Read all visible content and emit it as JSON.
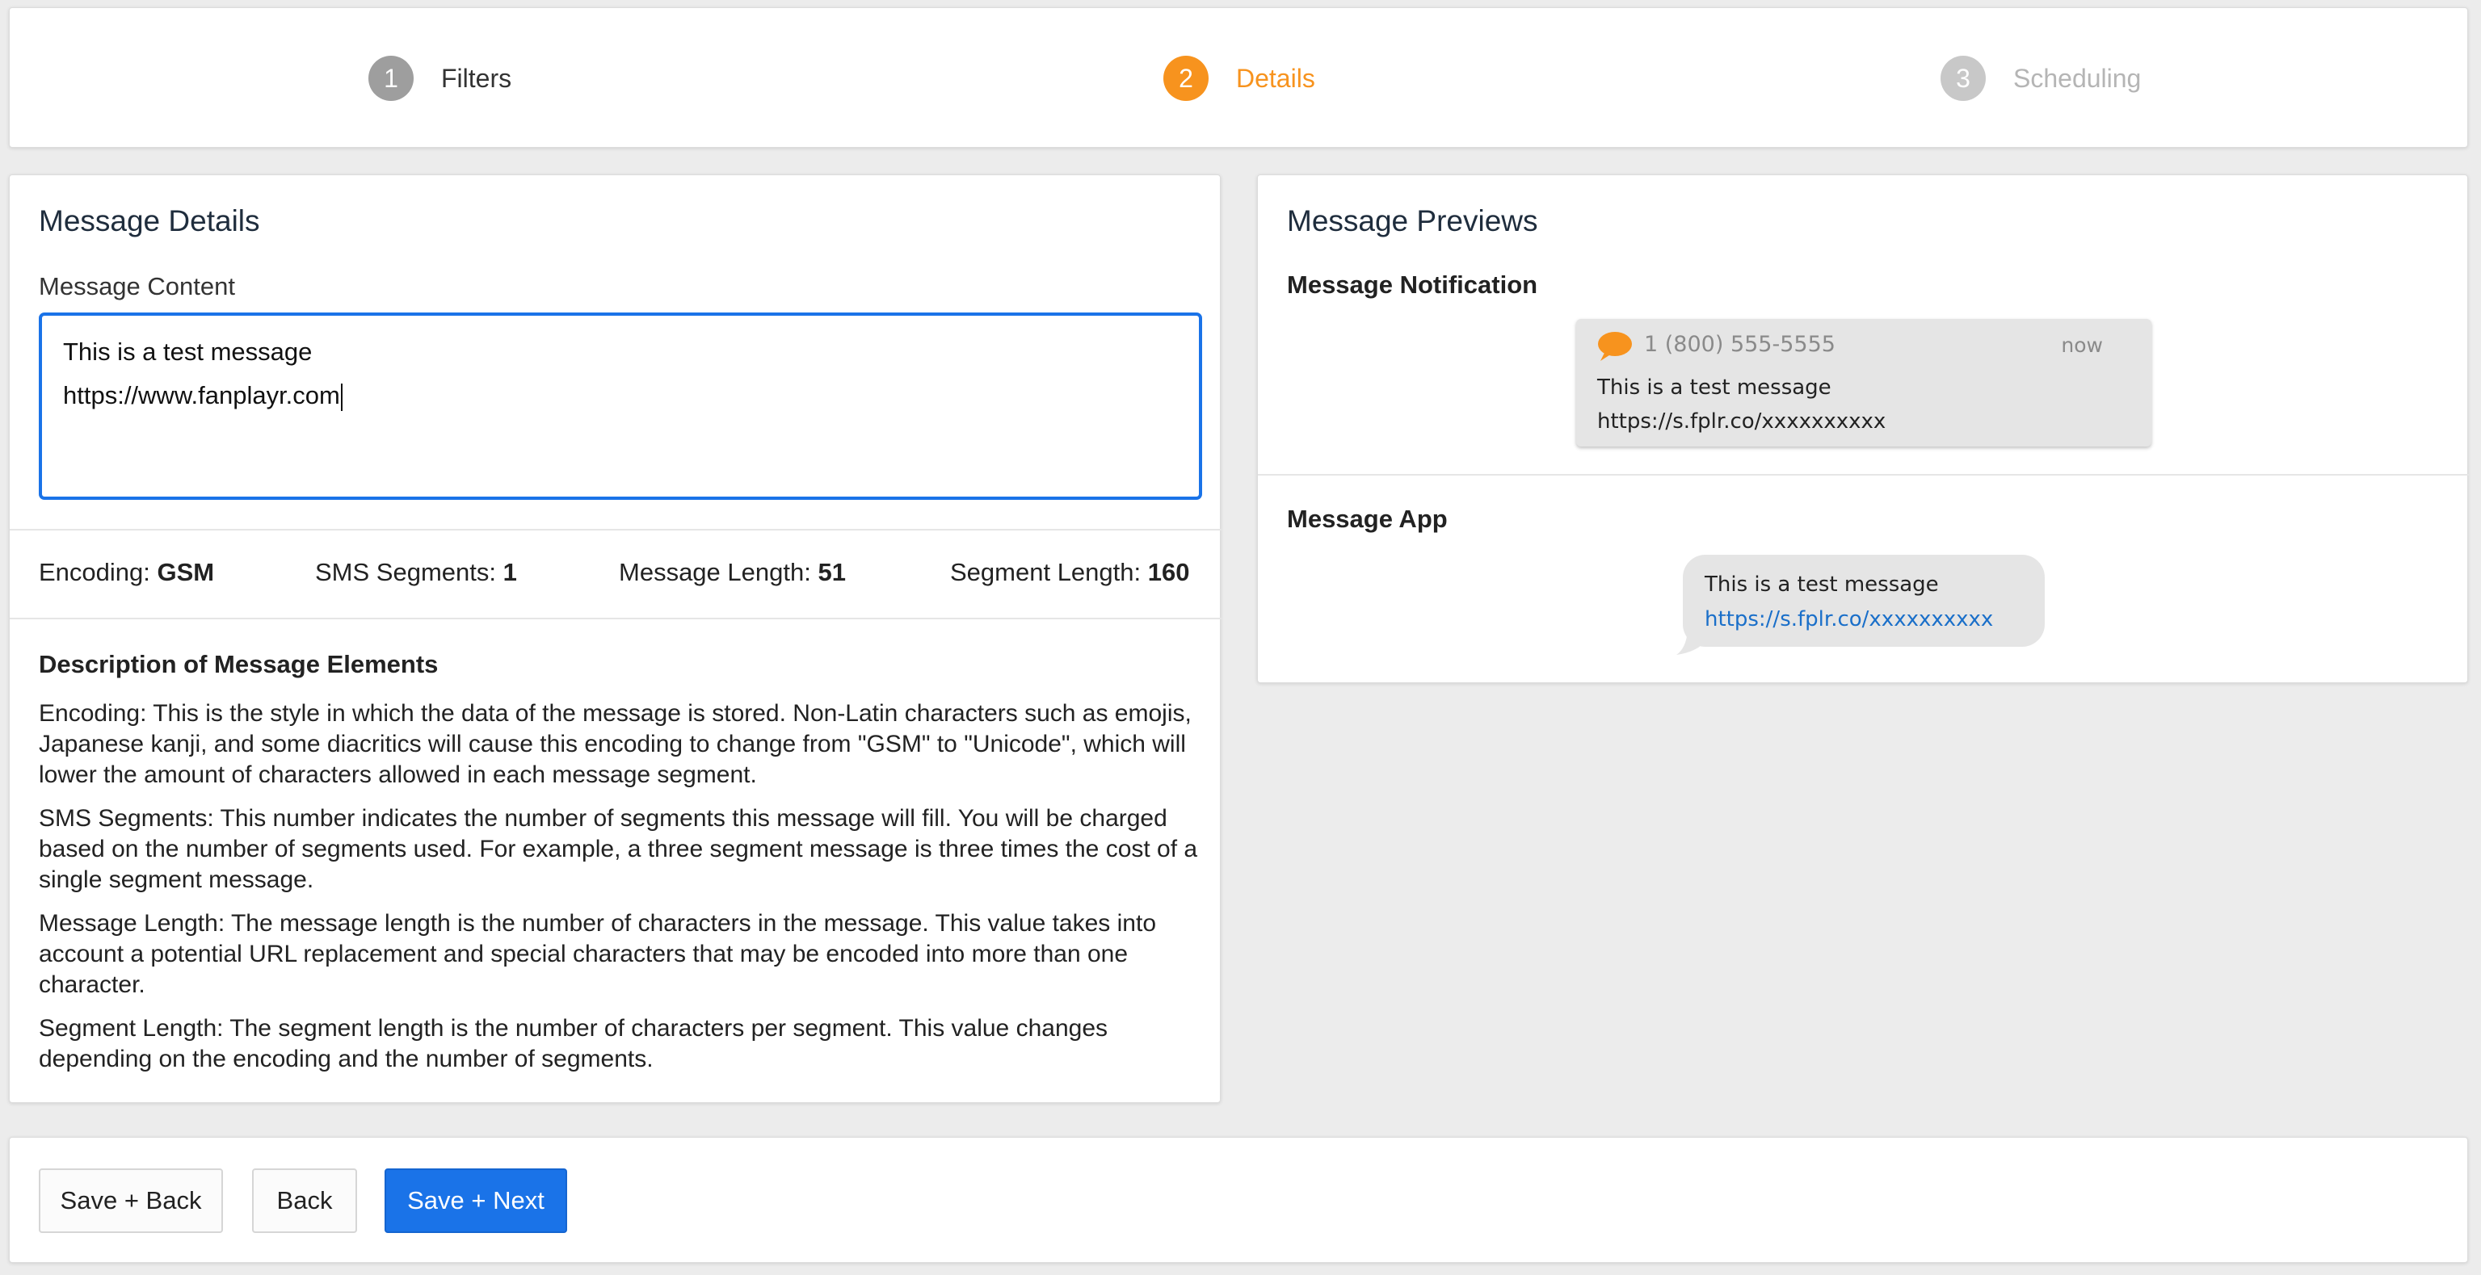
{
  "stepper": {
    "steps": [
      {
        "number": "1",
        "label": "Filters",
        "state": "completed"
      },
      {
        "number": "2",
        "label": "Details",
        "state": "active"
      },
      {
        "number": "3",
        "label": "Scheduling",
        "state": "upcoming"
      }
    ]
  },
  "details": {
    "title": "Message Details",
    "content_label": "Message Content",
    "message_lines": [
      "This is a test message",
      "https://www.fanplayr.com"
    ],
    "stats": {
      "encoding_label": "Encoding:",
      "encoding_value": "GSM",
      "segments_label": "SMS Segments:",
      "segments_value": "1",
      "length_label": "Message Length:",
      "length_value": "51",
      "segment_length_label": "Segment Length:",
      "segment_length_value": "160"
    },
    "description_title": "Description of Message Elements",
    "descriptions": [
      "Encoding: This is the style in which the data of the message is stored. Non-Latin characters such as emojis, Japanese kanji, and some diacritics will cause this encoding to change from \"GSM\" to \"Unicode\", which will lower the amount of characters allowed in each message segment.",
      "SMS Segments: This number indicates the number of segments this message will fill. You will be charged based on the number of segments used. For example, a three segment message is three times the cost of a single segment message.",
      "Message Length: The message length is the number of characters in the message. This value takes into account a potential URL replacement and special characters that may be encoded into more than one character.",
      "Segment Length: The segment length is the number of characters per segment. This value changes depending on the encoding and the number of segments."
    ]
  },
  "preview": {
    "title": "Message Previews",
    "notification_title": "Message Notification",
    "notification": {
      "icon": "chat-bubble-icon",
      "phone": "1 (800) 555-5555",
      "time": "now",
      "line1": "This is a test message",
      "line2": "https://s.fplr.co/xxxxxxxxxx"
    },
    "app_title": "Message App",
    "app_bubble": {
      "line1": "This is a test message",
      "link": "https://s.fplr.co/xxxxxxxxxx"
    }
  },
  "footer": {
    "save_back_label": "Save + Back",
    "back_label": "Back",
    "save_next_label": "Save + Next"
  },
  "colors": {
    "accent": "#f7931e",
    "primary": "#1a73e8",
    "link": "#1a6fc9"
  }
}
